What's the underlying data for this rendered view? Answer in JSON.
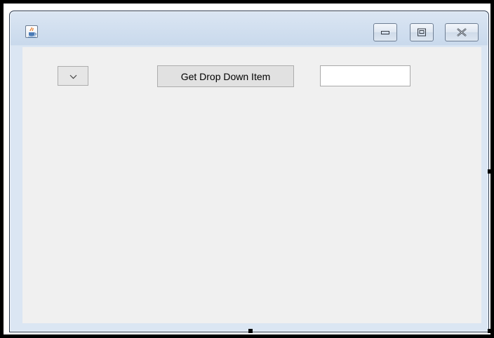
{
  "window": {
    "title": "",
    "icon": "java-coffee-cup-icon",
    "controls": {
      "minimize_icon": "minimize-icon",
      "maximize_icon": "maximize-icon",
      "close_icon": "close-icon"
    }
  },
  "form": {
    "dropdown": {
      "selected": "",
      "icon": "chevron-down-icon"
    },
    "get_button_label": "Get Drop Down Item",
    "text_field_value": ""
  },
  "colors": {
    "client_background": "#f0f0f0",
    "title_bar": "#c9d9ec",
    "button_background": "#e1e1e1"
  }
}
